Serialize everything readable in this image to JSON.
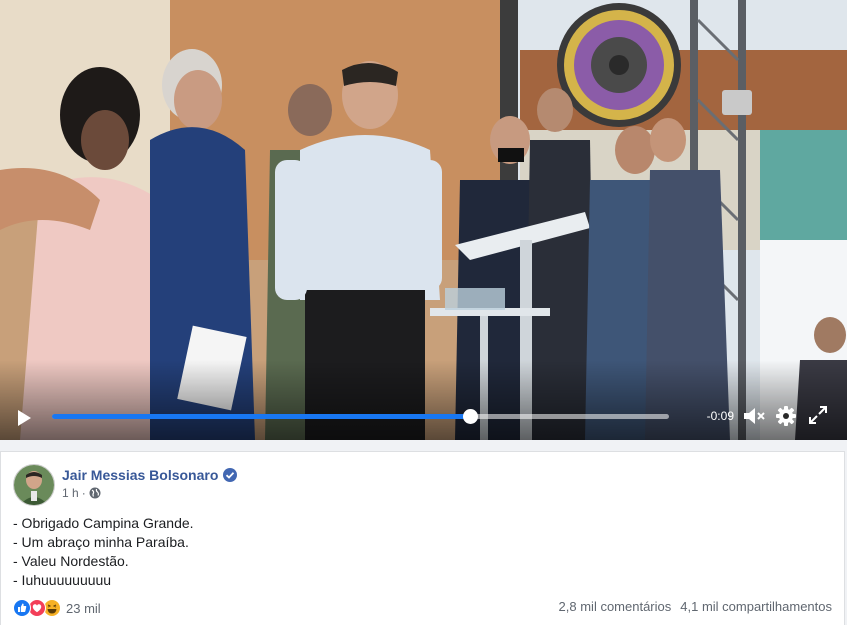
{
  "video": {
    "time_remaining": "-0:09",
    "progress_fraction": 0.677
  },
  "post": {
    "author": "Jair Messias Bolsonaro",
    "timestamp": "1 h",
    "separator": "·",
    "lines": [
      "- Obrigado Campina Grande.",
      "- Um abraço minha Paraíba.",
      "- Valeu Nordestão.",
      "- Iuhuuuuuuuuu"
    ],
    "reactions_count": "23 mil",
    "comments": "2,8 mil comentários",
    "shares": "4,1 mil compartilhamentos"
  },
  "colors": {
    "accent": "#1877f2",
    "author_link": "#385898",
    "muted_text": "#606770"
  },
  "icons": {
    "play": "play-icon",
    "mute": "volume-muted-icon",
    "settings": "gear-icon",
    "fullscreen": "fullscreen-icon",
    "verified": "verified-badge-icon",
    "audience": "globe-icon",
    "reactions": [
      "like-icon",
      "love-icon",
      "haha-icon"
    ]
  }
}
